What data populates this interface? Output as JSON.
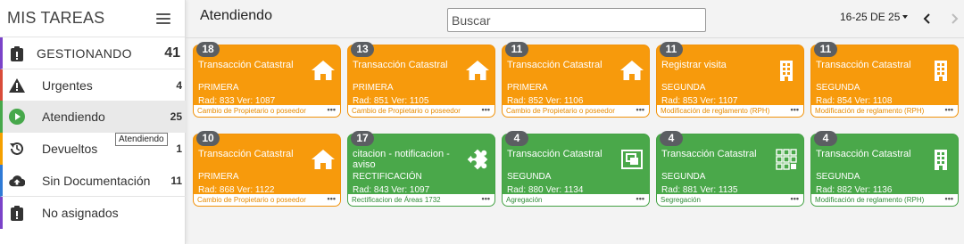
{
  "sidebar": {
    "title": "MIS TAREAS",
    "items": [
      {
        "label": "GESTIONANDO",
        "count": "41"
      },
      {
        "label": "Urgentes",
        "count": "4"
      },
      {
        "label": "Atendiendo",
        "count": "25"
      },
      {
        "label": "Devueltos",
        "count": "1"
      },
      {
        "label": "Sin Documentación",
        "count": "11"
      },
      {
        "label": "No asignados",
        "count": ""
      }
    ],
    "tooltip": "Atendiendo"
  },
  "header": {
    "title": "Atendiendo",
    "search_placeholder": "Buscar",
    "pagination": "16-25 DE 25"
  },
  "colors": {
    "orange": "#f79a0c",
    "green": "#4aa84a",
    "badge": "#5b5e62"
  },
  "cards": [
    {
      "badge": "18",
      "title": "Transacción Catastral",
      "priority": "PRIMERA",
      "rad": "Rad: 833 Ver: 1087",
      "footer": "Cambio de Propietario o poseedor",
      "icon": "house-icon",
      "color": "orange"
    },
    {
      "badge": "13",
      "title": "Transacción Catastral",
      "priority": "PRIMERA",
      "rad": "Rad: 851 Ver: 1105",
      "footer": "Cambio de Propietario o poseedor",
      "icon": "house-icon",
      "color": "orange"
    },
    {
      "badge": "11",
      "title": "Transacción Catastral",
      "priority": "PRIMERA",
      "rad": "Rad: 852 Ver: 1106",
      "footer": "Cambio de Propietario o poseedor",
      "icon": "house-icon",
      "color": "orange"
    },
    {
      "badge": "11",
      "title": "Registrar visita",
      "priority": "SEGUNDA",
      "rad": "Rad: 853 Ver: 1107",
      "footer": "Modificación de reglamento (RPH)",
      "icon": "building-icon",
      "color": "orange"
    },
    {
      "badge": "11",
      "title": "Transacción Catastral",
      "priority": "SEGUNDA",
      "rad": "Rad: 854 Ver: 1108",
      "footer": "Modificación de reglamento (RPH)",
      "icon": "building-icon",
      "color": "orange"
    },
    {
      "badge": "10",
      "title": "Transacción Catastral",
      "priority": "PRIMERA",
      "rad": "Rad: 868 Ver: 1122",
      "footer": "Cambio de Propietario o poseedor",
      "icon": "house-icon",
      "color": "orange"
    },
    {
      "badge": "17",
      "title": "citacion - notificacion - aviso",
      "priority": "RECTIFICACIÓN",
      "rad": "Rad: 843 Ver: 1097",
      "footer": "Rectificacion de Áreas 1732",
      "icon": "puzzle-icon",
      "color": "green"
    },
    {
      "badge": "4",
      "title": "Transacción Catastral",
      "priority": "SEGUNDA",
      "rad": "Rad: 880 Ver: 1134",
      "footer": "Agregación",
      "icon": "merge-icon",
      "color": "green"
    },
    {
      "badge": "4",
      "title": "Transacción Catastral",
      "priority": "SEGUNDA",
      "rad": "Rad: 881 Ver: 1135",
      "footer": "Segregación",
      "icon": "grid-icon",
      "color": "green"
    },
    {
      "badge": "4",
      "title": "Transacción Catastral",
      "priority": "SEGUNDA",
      "rad": "Rad: 882 Ver: 1136",
      "footer": "Modificación de reglamento (RPH)",
      "icon": "building-icon",
      "color": "green"
    }
  ]
}
